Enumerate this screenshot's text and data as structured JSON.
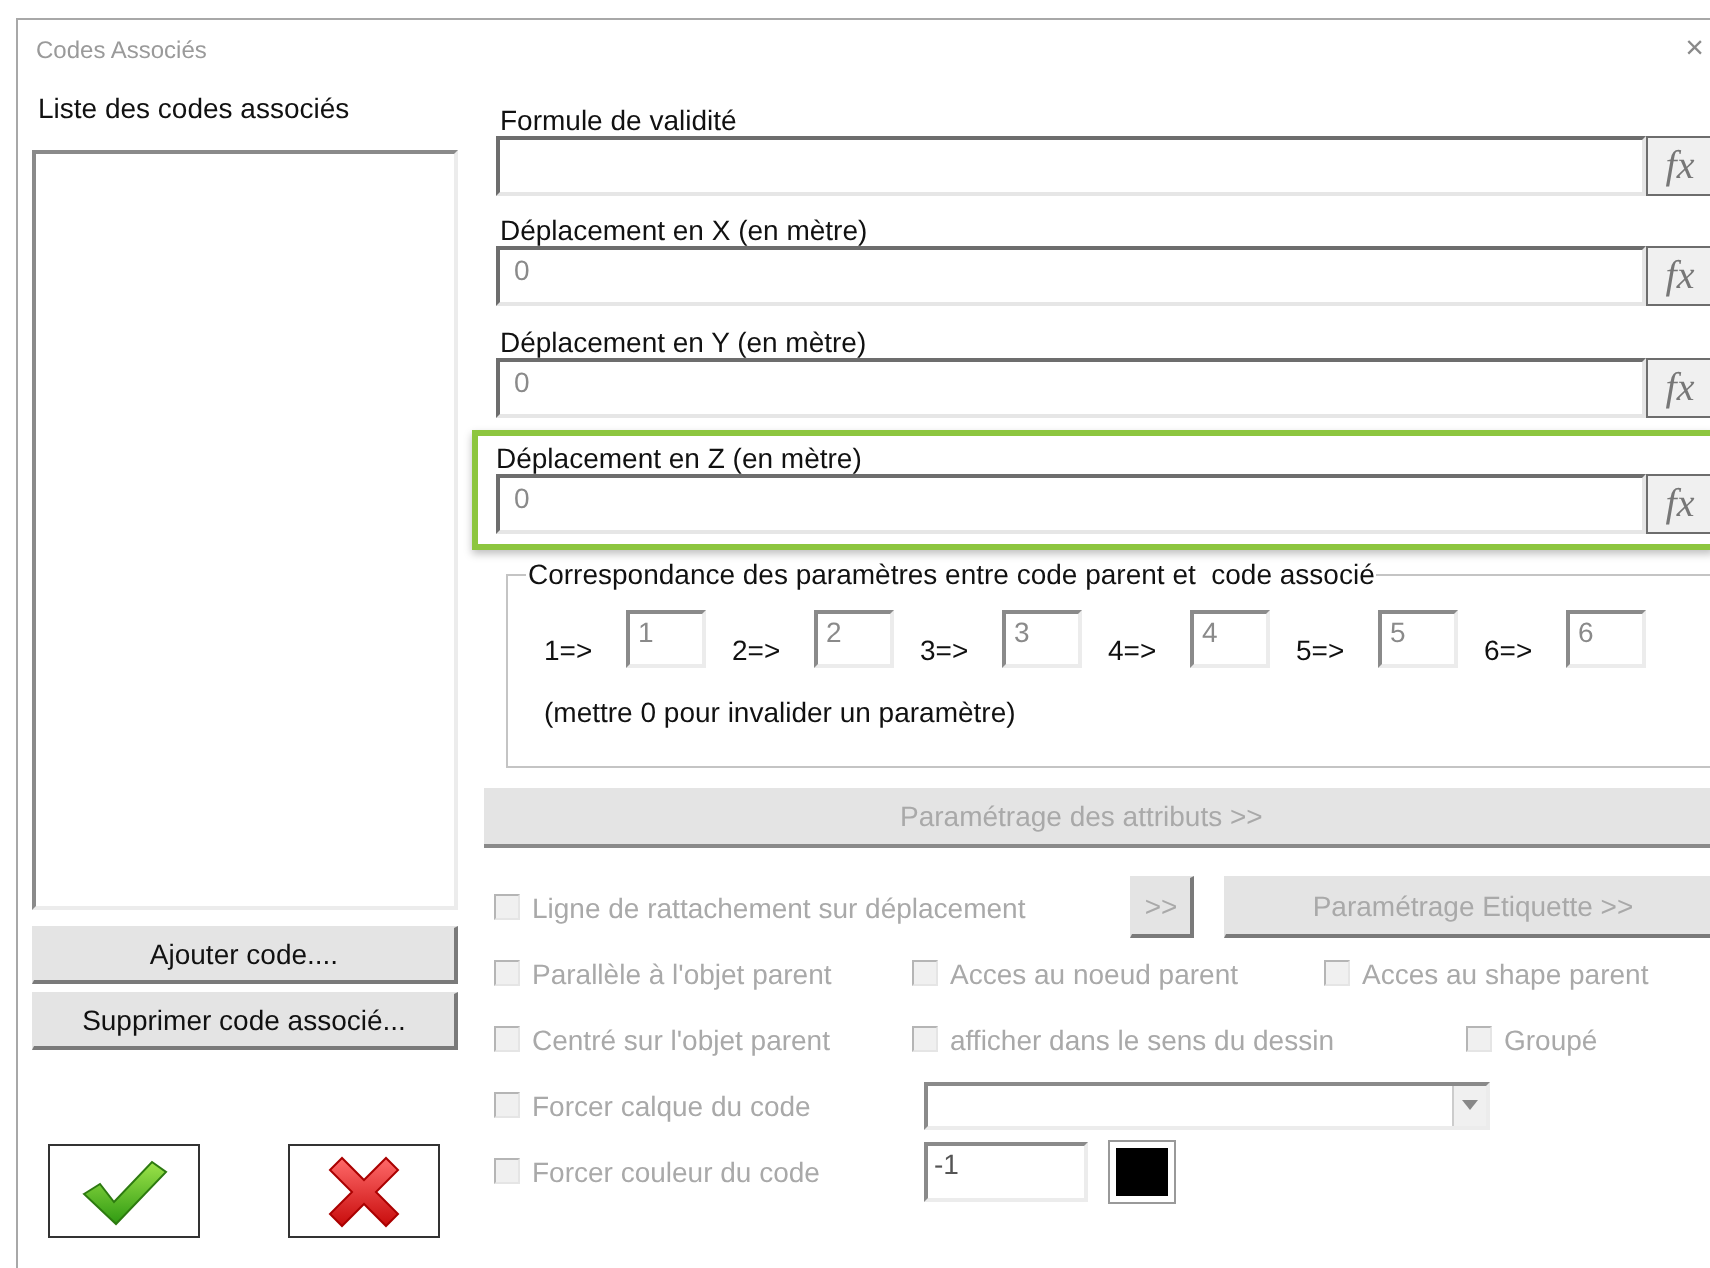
{
  "window": {
    "title": "Codes Associés",
    "close": "×"
  },
  "codes_list": {
    "label": "Liste des codes associés"
  },
  "list_buttons": [
    {
      "label": "Ajouter code...."
    },
    {
      "label": "Supprimer code associé..."
    }
  ],
  "dialog_buttons": [
    {
      "kind": "confirm"
    },
    {
      "kind": "cancel"
    }
  ],
  "fields": [
    {
      "label": "Formule de validité",
      "button": "fx",
      "highlighted": false
    },
    {
      "label": "Déplacement en X (en mètre)",
      "value": "0",
      "button": "fx",
      "highlighted": false
    },
    {
      "label": "Déplacement en Y (en mètre)",
      "value": "0",
      "button": "fx",
      "highlighted": false
    },
    {
      "label": "Déplacement en Z (en mètre)",
      "value": "0",
      "button": "fx",
      "highlighted": true
    }
  ],
  "mapping": {
    "title": "Correspondance des paramètres entre code parent et  code associé",
    "pairs": [
      {
        "label": "1=>",
        "value": "1"
      },
      {
        "label": "2=>",
        "value": "2"
      },
      {
        "label": "3=>",
        "value": "3"
      },
      {
        "label": "4=>",
        "value": "4"
      },
      {
        "label": "5=>",
        "value": "5"
      },
      {
        "label": "6=>",
        "value": "6"
      }
    ],
    "note": "(mettre 0 pour invalider un paramètre)"
  },
  "attributes_button": {
    "label": "Paramétrage des attributs >>",
    "disabled": true
  },
  "option_rows": [
    {
      "items": [
        {
          "kind": "checkbox",
          "label": "Ligne de rattachement sur déplacement",
          "checked": false,
          "disabled": true
        },
        {
          "kind": "button",
          "label": ">>",
          "disabled": true
        },
        {
          "kind": "button",
          "label": "Paramétrage Etiquette >>",
          "disabled": true
        }
      ]
    },
    {
      "items": [
        {
          "kind": "checkbox",
          "label": "Parallèle à l'objet parent",
          "checked": false,
          "disabled": true
        },
        {
          "kind": "checkbox",
          "label": "Acces au noeud parent",
          "checked": false,
          "disabled": true
        },
        {
          "kind": "checkbox",
          "label": "Acces au shape parent",
          "checked": false,
          "disabled": true
        }
      ]
    },
    {
      "items": [
        {
          "kind": "checkbox",
          "label": "Centré sur l'objet parent",
          "checked": false,
          "disabled": true
        },
        {
          "kind": "checkbox",
          "label": "afficher dans le sens du dessin",
          "checked": false,
          "disabled": true
        },
        {
          "kind": "checkbox",
          "label": "Groupé",
          "checked": false,
          "disabled": true
        }
      ]
    },
    {
      "items": [
        {
          "kind": "checkbox",
          "label": "Forcer calque du code",
          "checked": false,
          "disabled": true
        },
        {
          "kind": "dropdown"
        }
      ]
    },
    {
      "items": [
        {
          "kind": "checkbox",
          "label": "Forcer couleur du code",
          "checked": false,
          "disabled": true
        },
        {
          "kind": "number",
          "value": "-1"
        },
        {
          "kind": "swatch",
          "color": "#000000"
        }
      ]
    }
  ]
}
